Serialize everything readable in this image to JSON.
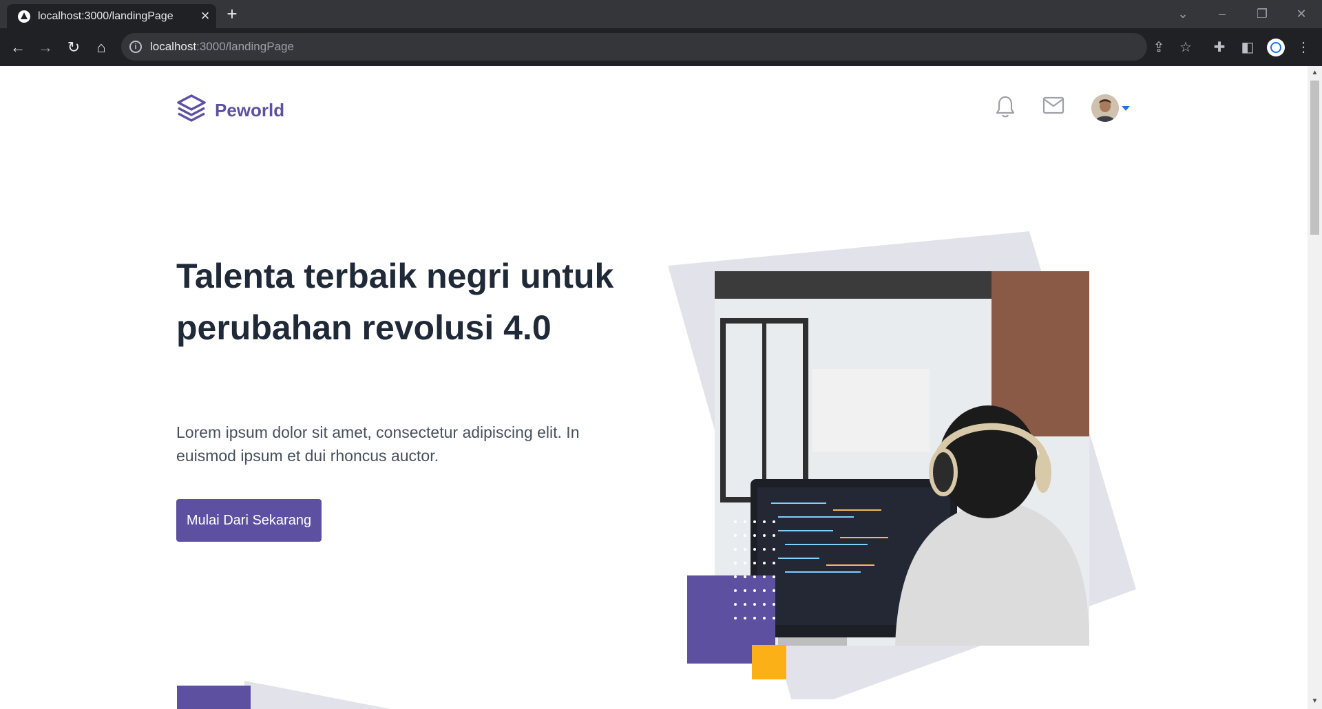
{
  "browser": {
    "tab_title": "localhost:3000/landingPage",
    "url_host": "localhost",
    "url_rest": ":3000/landingPage",
    "new_tab_icon": "plus-icon",
    "close_tab_icon": "close-icon"
  },
  "nav": {
    "brand": "Peworld",
    "icons": [
      "bell-icon",
      "mail-icon",
      "user-avatar",
      "caret-down-icon"
    ]
  },
  "hero": {
    "title": "Talenta terbaik negri untuk perubahan revolusi 4.0",
    "description": "Lorem ipsum dolor sit amet, consectetur adipiscing elit. In euismod ipsum et dui rhoncus auctor.",
    "cta_label": "Mulai Dari Sekarang"
  },
  "colors": {
    "primary": "#5e50a1",
    "accent": "#fbb017",
    "decor_gray": "#e2e3ea",
    "heading": "#1f2937"
  }
}
